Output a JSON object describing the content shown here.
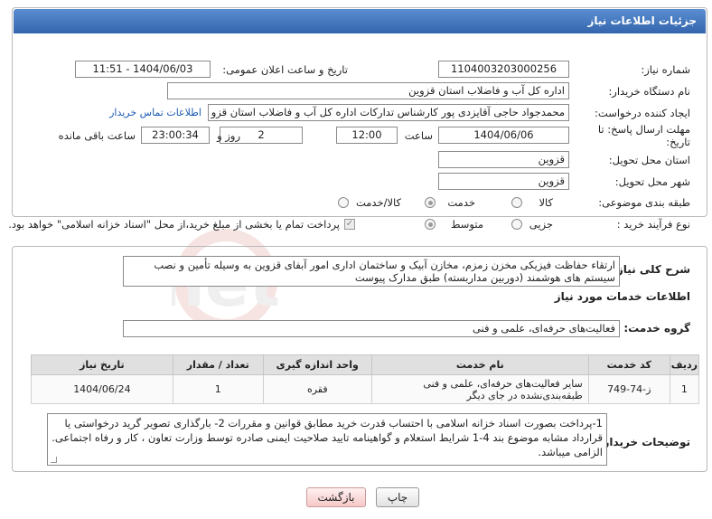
{
  "header": {
    "title": "جزئیات اطلاعات نیاز"
  },
  "fields": {
    "need_number_label": "شماره نیاز:",
    "need_number": "1104003203000256",
    "announce_label": "تاریخ و ساعت اعلان عمومی:",
    "announce_value": "1404/06/03 - 11:51",
    "buyer_org_label": "نام دستگاه خریدار:",
    "buyer_org": "اداره کل آب و فاضلاب استان قزوین",
    "creator_label": "ایجاد کننده درخواست:",
    "creator": "محمدجواد حاجی آقایزدی پور کارشناس تدارکات اداره کل آب و فاضلاب استان قزو",
    "contact_link": "اطلاعات تماس خریدار",
    "deadline_label": "مهلت ارسال پاسخ: تا تاریخ:",
    "deadline_date": "1404/06/06",
    "time_label": "ساعت",
    "deadline_time": "12:00",
    "days_value": "2",
    "days_label": "روز و",
    "remaining_time": "23:00:34",
    "remaining_label": "ساعت باقی مانده",
    "province_label": "استان محل تحویل:",
    "province": "قزوین",
    "city_label": "شهر محل تحویل:",
    "city": "قزوین",
    "category_label": "طبقه بندی موضوعی:",
    "category_options": [
      "کالا",
      "خدمت",
      "کالا/خدمت"
    ],
    "category_selected": "خدمت",
    "process_label": "نوع فرآیند خرید :",
    "process_options": [
      "جزیی",
      "متوسط"
    ],
    "process_selected": "متوسط",
    "payment_note": "پرداخت تمام یا بخشی از مبلغ خرید،از محل \"اسناد خزانه اسلامی\" خواهد بود."
  },
  "description": {
    "label": "شرح کلی نیاز:",
    "text": "ارتقاء حفاظت فیزیکی مخزن زمزم، مخازن آبیک و ساختمان اداری امور آبفای قزوین به وسیله تأمین و نصب سیستم های هوشمند (دوربین مداربسته) طبق مدارک پیوست"
  },
  "services": {
    "title": "اطلاعات خدمات مورد نیاز",
    "group_label": "گروه خدمت:",
    "group_value": "فعالیت‌های حرفه‌ای، علمی و فنی",
    "columns": [
      "ردیف",
      "کد خدمت",
      "نام خدمت",
      "واحد اندازه گیری",
      "تعداد / مقدار",
      "تاریخ نیاز"
    ],
    "rows": [
      {
        "row": "1",
        "code": "ز-74-749",
        "name": "سایر فعالیت‌های حرفه‌ای، علمی و فنی طبقه‌بندی‌نشده در جای دیگر",
        "unit": "فقره",
        "qty": "1",
        "date": "1404/06/24"
      }
    ]
  },
  "buyer_notes": {
    "label": "توضیحات خریدار:",
    "text": "1-پرداخت بصورت اسناد خزانه اسلامی با احتساب قدرت خرید مطابق قوانین و مقررات 2- بارگذاری تصویر گرید درخواستی یا قرارداد مشابه موضوع بند 4-1 شرایط استعلام و گواهینامه تایید صلاحیت ایمنی صادره توسط وزارت تعاون ، کار و رفاه اجتماعی. الزامی میباشد."
  },
  "buttons": {
    "print": "چاپ",
    "back": "بازگشت"
  },
  "watermark_text": "AriaTender.net",
  "colors": {
    "header": "#3f74bd",
    "link": "#1c5bb5",
    "watermark": "#c0392b"
  }
}
